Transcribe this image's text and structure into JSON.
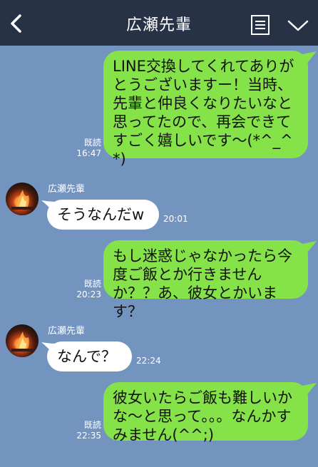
{
  "header": {
    "title": "広瀬先輩"
  },
  "messages": [
    {
      "side": "me",
      "text": "LINE交換してくれてありがとうございますー！当時、先輩と仲良くなりたいなと思ってたので、再会できてすごく嬉しいです〜(*^_^*)",
      "read": "既読",
      "time": "16:47"
    },
    {
      "side": "them",
      "sender": "広瀬先輩",
      "text": "そうなんだw",
      "time": "20:01"
    },
    {
      "side": "me",
      "text": "もし迷惑じゃなかったら今度ご飯とか行きませんか？？あ、彼女とかいます？",
      "read": "既読",
      "time": "20:23"
    },
    {
      "side": "them",
      "sender": "広瀬先輩",
      "text": "なんで？",
      "time": "22:24"
    },
    {
      "side": "me",
      "text": "彼女いたらご飯も難しいかな〜と思って。。。なんかすみません(^^;)",
      "read": "既読",
      "time": "22:35"
    }
  ]
}
